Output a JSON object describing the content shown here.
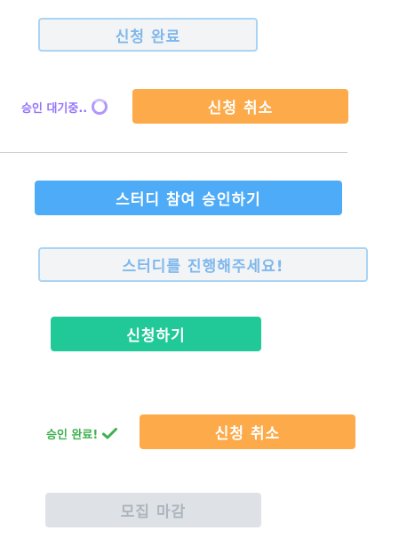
{
  "buttons": {
    "application_complete": "신청 완료",
    "cancel_application_1": "신청 취소",
    "approve_participation": "스터디 참여 승인하기",
    "proceed_study": "스터디를 진행해주세요!",
    "apply": "신청하기",
    "cancel_application_2": "신청 취소",
    "recruitment_closed": "모집 마감"
  },
  "status": {
    "awaiting_approval": "승인 대기중..",
    "approved": "승인 완료!"
  },
  "icons": {
    "spinner": "loading-spinner",
    "check": "check-icon"
  },
  "colors": {
    "orange": "#fcaa4a",
    "blue": "#4dabf7",
    "green": "#20c997",
    "disabled": "#dee2e6",
    "outline_border": "#a9d4f5",
    "status_wait": "#9775fa",
    "status_ok": "#40b050"
  }
}
